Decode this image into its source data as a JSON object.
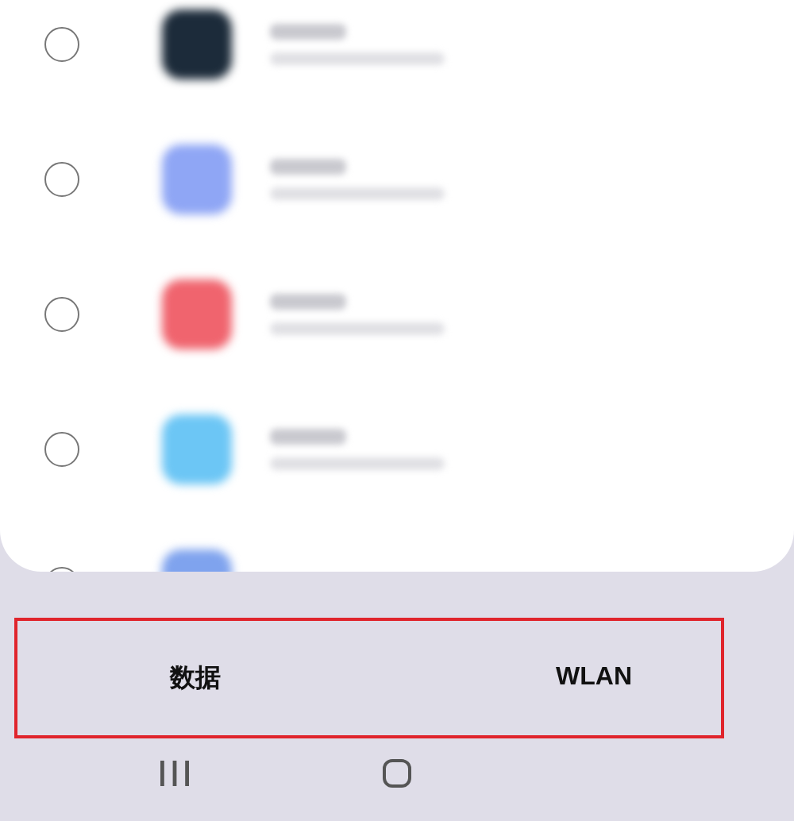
{
  "apps": [
    {
      "color": "#1c2b3a",
      "selected": false
    },
    {
      "color": "#8fa6f5",
      "selected": false
    },
    {
      "color": "#f0646e",
      "selected": false
    },
    {
      "color": "#6cc6f5",
      "selected": false
    },
    {
      "color": "#7fa3ee",
      "selected": false
    }
  ],
  "tabs": [
    {
      "label": "数据"
    },
    {
      "label": "WLAN"
    }
  ]
}
